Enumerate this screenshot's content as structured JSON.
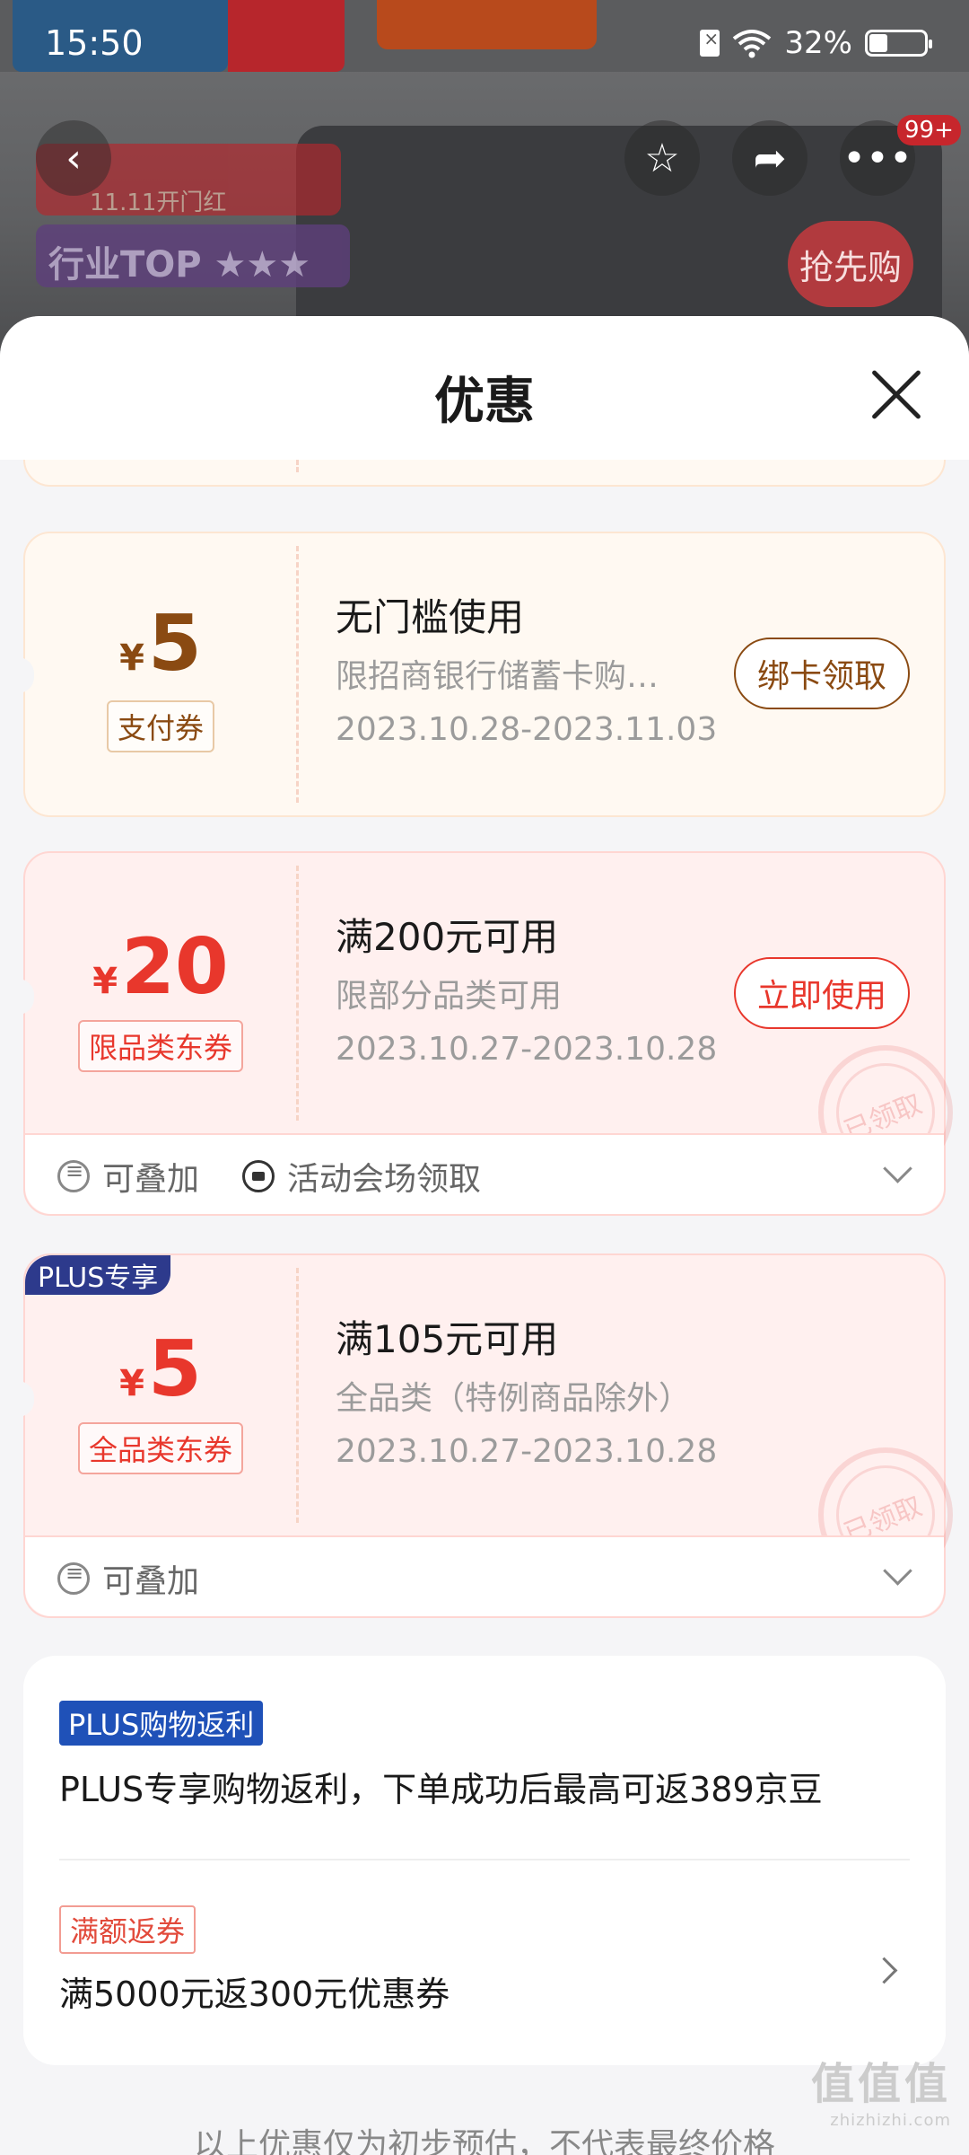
{
  "status_bar": {
    "time": "15:50",
    "battery": "32%"
  },
  "background": {
    "promo_text": "行业TOP ★★★",
    "promo_sub": "11.11开门红",
    "rush_label": "抢先购",
    "cart_badge": "99+"
  },
  "sheet": {
    "title": "优惠"
  },
  "coupons": [
    {
      "amount": "5",
      "type": "支付券",
      "title": "无门槛使用",
      "desc": "限招商银行储蓄卡购买部分商品",
      "date": "2023.10.28-2023.11.03",
      "action": "绑卡领取"
    },
    {
      "amount": "20",
      "type": "限品类东券",
      "title": "满200元可用",
      "desc": "限部分品类可用",
      "date": "2023.10.27-2023.10.28",
      "action": "立即使用",
      "stamp": "已领取",
      "footer": [
        "可叠加",
        "活动会场领取"
      ]
    },
    {
      "tag": "PLUS专享",
      "amount": "5",
      "type": "全品类东券",
      "title": "满105元可用",
      "desc": "全品类（特例商品除外）",
      "date": "2023.10.27-2023.10.28",
      "stamp": "已领取",
      "footer": [
        "可叠加"
      ]
    }
  ],
  "rebates": [
    {
      "tag": "PLUS购物返利",
      "text": "PLUS专享购物返利，下单成功后最高可返389京豆"
    },
    {
      "tag": "满额返券",
      "text": "满5000元返300元优惠券"
    }
  ],
  "disclaimer": "以上优惠仅为初步预估，不代表最终价格",
  "watermark": {
    "main": "值值值",
    "sub": "zhizhizhi.com"
  },
  "colors": {
    "coupon_brown": "#8a4a12",
    "coupon_red": "#e8372c",
    "plus_blue": "#2d3a8c",
    "rebate_blue": "#1f51b8"
  }
}
